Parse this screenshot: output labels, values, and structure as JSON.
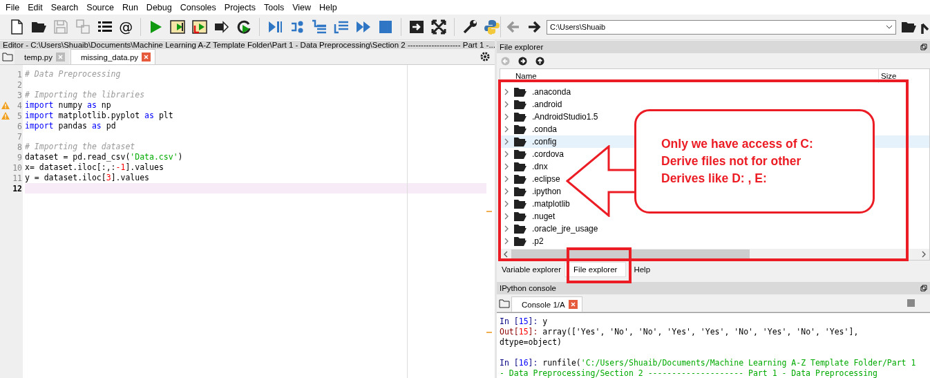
{
  "menu": [
    "File",
    "Edit",
    "Search",
    "Source",
    "Run",
    "Debug",
    "Consoles",
    "Projects",
    "Tools",
    "View",
    "Help"
  ],
  "toolbar": {
    "at_button": "@",
    "path": "C:\\Users\\Shuaib"
  },
  "editor": {
    "title": "Editor - C:\\Users\\Shuaib\\Documents\\Machine Learning A-Z Template Folder\\Part 1 - Data Preprocessing\\Section 2 -------------------- Part 1 -...",
    "tabs": [
      {
        "label": "temp.py",
        "selected": false
      },
      {
        "label": "missing_data.py",
        "selected": true
      }
    ],
    "lines": [
      {
        "number": "1",
        "warning": false,
        "current": false,
        "tokens": [
          {
            "kind": "comment",
            "text": "# Data Preprocessing"
          }
        ]
      },
      {
        "number": "2",
        "warning": false,
        "current": false
      },
      {
        "number": "3",
        "warning": false,
        "current": false,
        "tokens": [
          {
            "kind": "comment",
            "text": "# Importing the libraries"
          }
        ]
      },
      {
        "number": "4",
        "warning": true,
        "current": false,
        "tokens": [
          {
            "kind": "keyword",
            "text": "import"
          },
          {
            "kind": "plain",
            "text": " numpy "
          },
          {
            "kind": "keyword",
            "text": "as"
          },
          {
            "kind": "plain",
            "text": " np"
          }
        ]
      },
      {
        "number": "5",
        "warning": true,
        "current": false,
        "tokens": [
          {
            "kind": "keyword",
            "text": "import"
          },
          {
            "kind": "plain",
            "text": " matplotlib.pyplot "
          },
          {
            "kind": "keyword",
            "text": "as"
          },
          {
            "kind": "plain",
            "text": " plt"
          }
        ]
      },
      {
        "number": "6",
        "warning": false,
        "current": false,
        "tokens": [
          {
            "kind": "keyword",
            "text": "import"
          },
          {
            "kind": "plain",
            "text": " pandas "
          },
          {
            "kind": "keyword",
            "text": "as"
          },
          {
            "kind": "plain",
            "text": " pd"
          }
        ]
      },
      {
        "number": "7",
        "warning": false,
        "current": false
      },
      {
        "number": "8",
        "warning": false,
        "current": false,
        "tokens": [
          {
            "kind": "comment",
            "text": "# Importing the dataset"
          }
        ]
      },
      {
        "number": "9",
        "warning": false,
        "current": false,
        "tokens": [
          {
            "kind": "plain",
            "text": "dataset = pd.read_csv("
          },
          {
            "kind": "string",
            "text": "'Data.csv'"
          },
          {
            "kind": "plain",
            "text": ")"
          }
        ]
      },
      {
        "number": "10",
        "warning": false,
        "current": false,
        "tokens": [
          {
            "kind": "plain",
            "text": "x= dataset.iloc[:,:"
          },
          {
            "kind": "number",
            "text": "-1"
          },
          {
            "kind": "plain",
            "text": "].values"
          }
        ]
      },
      {
        "number": "11",
        "warning": false,
        "current": false,
        "tokens": [
          {
            "kind": "plain",
            "text": "y = dataset.iloc["
          },
          {
            "kind": "number",
            "text": "3"
          },
          {
            "kind": "plain",
            "text": "].values"
          }
        ]
      },
      {
        "number": "12",
        "warning": false,
        "current": true
      }
    ]
  },
  "file_explorer": {
    "title": "File explorer",
    "columns": [
      "Name",
      "Size"
    ],
    "items": [
      {
        "name": ".anaconda",
        "selected": false
      },
      {
        "name": ".android",
        "selected": false
      },
      {
        "name": ".AndroidStudio1.5",
        "selected": false
      },
      {
        "name": ".conda",
        "selected": false
      },
      {
        "name": ".config",
        "selected": true
      },
      {
        "name": ".cordova",
        "selected": false
      },
      {
        "name": ".dnx",
        "selected": false
      },
      {
        "name": ".eclipse",
        "selected": false
      },
      {
        "name": ".ipython",
        "selected": false
      },
      {
        "name": ".matplotlib",
        "selected": false
      },
      {
        "name": ".nuget",
        "selected": false
      },
      {
        "name": ".oracle_jre_usage",
        "selected": false
      },
      {
        "name": ".p2",
        "selected": false
      }
    ]
  },
  "pane_tabs": [
    {
      "label": "Variable explorer",
      "selected": false
    },
    {
      "label": "File explorer",
      "selected": true
    },
    {
      "label": "Help",
      "selected": false
    }
  ],
  "console": {
    "title": "IPython console",
    "tabs": [
      {
        "label": "Console 1/A",
        "selected": true
      }
    ],
    "blocks": [
      [
        [
          {
            "kind": "prompt-in",
            "text": "In ["
          },
          {
            "kind": "prompt-num",
            "text": "15"
          },
          {
            "kind": "prompt-in",
            "text": "]: "
          },
          {
            "kind": "plain",
            "text": "y"
          }
        ],
        [
          {
            "kind": "prompt-out",
            "text": "Out["
          },
          {
            "kind": "prompt-outnum",
            "text": "15"
          },
          {
            "kind": "prompt-out",
            "text": "]: "
          },
          {
            "kind": "plain",
            "text": "array(['Yes', 'No', 'No', 'Yes', 'Yes', 'No', 'Yes', 'No', 'Yes'],"
          }
        ],
        [
          {
            "kind": "plain",
            "text": "dtype=object)"
          }
        ]
      ],
      [
        [
          {
            "kind": "prompt-in",
            "text": "In ["
          },
          {
            "kind": "prompt-num",
            "text": "16"
          },
          {
            "kind": "prompt-in",
            "text": "]: "
          },
          {
            "kind": "plain",
            "text": "runfile("
          },
          {
            "kind": "string",
            "text": "'C:/Users/Shuaib/Documents/Machine Learning A-Z Template Folder/Part 1"
          }
        ],
        [
          {
            "kind": "string",
            "text": "- Data Preprocessing/Section 2 -------------------- Part 1 - Data Preprocessing"
          }
        ]
      ]
    ]
  },
  "annotation": {
    "note": [
      "Only we have access of C:",
      "Derive files not for other",
      "Derives like D: , E:"
    ]
  }
}
